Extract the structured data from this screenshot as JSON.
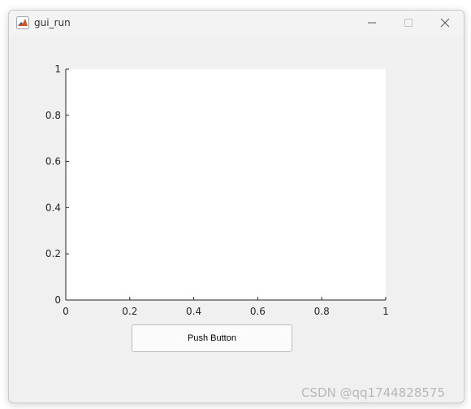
{
  "window": {
    "title": "gui_run",
    "icon": "matlab-logo-icon",
    "controls": {
      "minimize_icon": "minimize-icon",
      "maximize_icon": "maximize-icon",
      "close_icon": "close-icon"
    }
  },
  "axes": {
    "xlim": [
      0,
      1
    ],
    "ylim": [
      0,
      1
    ],
    "xticks": [
      "0",
      "0.2",
      "0.4",
      "0.6",
      "0.8",
      "1"
    ],
    "yticks": [
      "0",
      "0.2",
      "0.4",
      "0.6",
      "0.8",
      "1"
    ],
    "background": "#ffffff",
    "axis_color": "#262626"
  },
  "push_button": {
    "label": "Push Button"
  },
  "watermark": {
    "text": "CSDN @qq1744828575"
  },
  "colors": {
    "figure_background": "#f0f0f0",
    "titlebar_background": "#f3f3f3"
  }
}
